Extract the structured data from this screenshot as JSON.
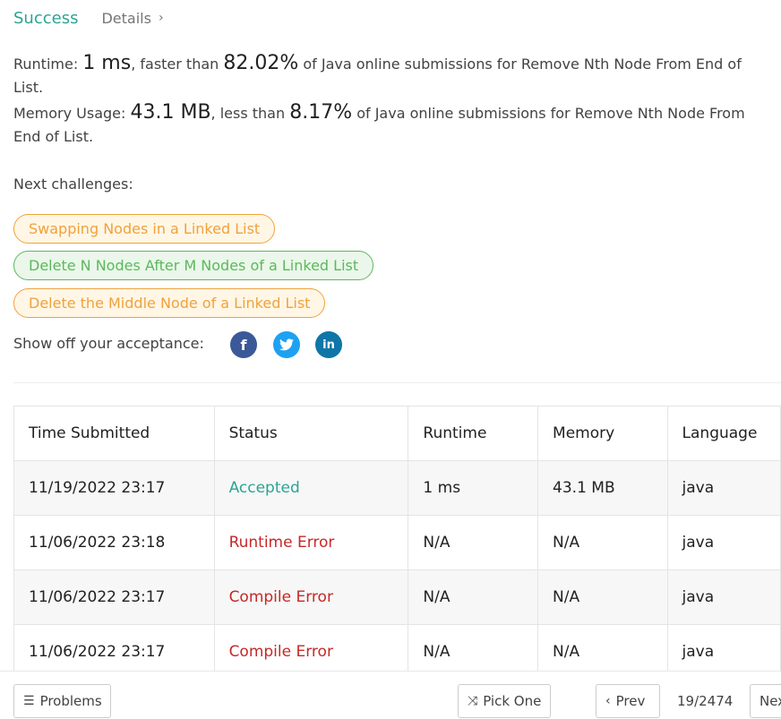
{
  "tabs": {
    "success": "Success",
    "details": "Details"
  },
  "runtime": {
    "label": "Runtime: ",
    "value": "1 ms",
    "middle": ", faster than ",
    "percent": "82.02%",
    "suffix": " of Java online submissions for Remove Nth Node From End of List."
  },
  "memory": {
    "label": "Memory Usage: ",
    "value": "43.1 MB",
    "middle": ", less than ",
    "percent": "8.17%",
    "suffix": " of Java online submissions for Remove Nth Node From End of List."
  },
  "next_challenges": {
    "label": "Next challenges:",
    "items": [
      {
        "label": "Swapping Nodes in a Linked List",
        "color": "#f0a23b"
      },
      {
        "label": "Delete N Nodes After M Nodes of a Linked List",
        "color": "#5cb85c"
      },
      {
        "label": "Delete the Middle Node of a Linked List",
        "color": "#f0a23b"
      }
    ]
  },
  "share": {
    "label": "Show off your acceptance:",
    "icons": [
      "facebook-icon",
      "twitter-icon",
      "linkedin-icon"
    ]
  },
  "table": {
    "headers": [
      "Time Submitted",
      "Status",
      "Runtime",
      "Memory",
      "Language"
    ],
    "rows": [
      {
        "time": "11/19/2022 23:17",
        "status": "Accepted",
        "runtime": "1 ms",
        "memory": "43.1 MB",
        "language": "java"
      },
      {
        "time": "11/06/2022 23:18",
        "status": "Runtime Error",
        "runtime": "N/A",
        "memory": "N/A",
        "language": "java"
      },
      {
        "time": "11/06/2022 23:17",
        "status": "Compile Error",
        "runtime": "N/A",
        "memory": "N/A",
        "language": "java"
      },
      {
        "time": "11/06/2022 23:17",
        "status": "Compile Error",
        "runtime": "N/A",
        "memory": "N/A",
        "language": "java"
      }
    ]
  },
  "footer": {
    "problems": "Problems",
    "pick_one": "Pick One",
    "prev": "Prev",
    "page": "19/2474",
    "next": "Next"
  },
  "colors": {
    "accent": "#2aa493",
    "error": "#c62828",
    "warning": "#f0a23b",
    "success_chip": "#5cb85c"
  }
}
